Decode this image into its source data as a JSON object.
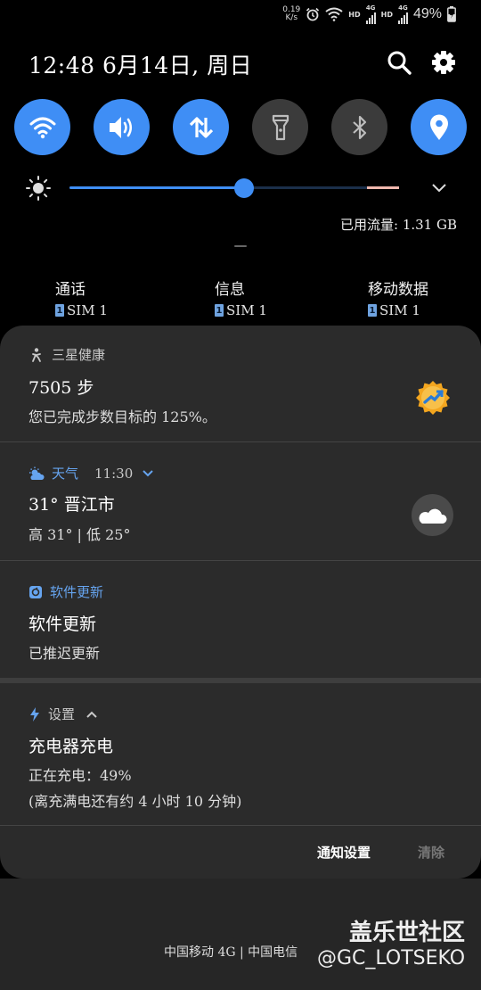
{
  "status_bar": {
    "net_speed_value": "0.19",
    "net_speed_unit": "K/s",
    "hd1": "HD",
    "net1": "4G",
    "hd2": "HD",
    "net2": "4G",
    "battery": "49%",
    "icons": [
      "alarm-icon",
      "wifi-icon",
      "signal-icon",
      "battery-charging-icon"
    ]
  },
  "header": {
    "datetime": "12:48  6月14日, 周日",
    "icons": [
      "search-icon",
      "gear-icon"
    ]
  },
  "quick_settings": {
    "toggles": [
      {
        "name": "wifi",
        "on": true
      },
      {
        "name": "sound",
        "on": true
      },
      {
        "name": "mobile-data",
        "on": true
      },
      {
        "name": "flashlight",
        "on": false
      },
      {
        "name": "bluetooth",
        "on": false
      },
      {
        "name": "location",
        "on": true
      }
    ],
    "brightness_level": 0.53,
    "data_used": "已用流量: 1.31 GB"
  },
  "sim": [
    {
      "title": "通话",
      "badge": "1",
      "label": "SIM 1"
    },
    {
      "title": "信息",
      "badge": "1",
      "label": "SIM 1"
    },
    {
      "title": "移动数据",
      "badge": "1",
      "label": "SIM 1"
    }
  ],
  "notifications": {
    "health": {
      "app": "三星健康",
      "title": "7505 步",
      "text": "您已完成步数目标的 125%。"
    },
    "weather": {
      "app": "天气",
      "time": "11:30",
      "title": "31° 晋江市",
      "text": "高 31° | 低 25°"
    },
    "update": {
      "app": "软件更新",
      "title": "软件更新",
      "text": "已推迟更新"
    },
    "charging": {
      "app": "设置",
      "title": "充电器充电",
      "line1": "正在充电：49%",
      "line2": "(离充满电还有约 4 小时 10 分钟)"
    }
  },
  "actions": {
    "settings": "通知设置",
    "clear": "清除"
  },
  "footer": {
    "carrier": "中国移动 4G | 中国电信"
  },
  "watermark": {
    "line1": "盖乐世社区",
    "line2": "@GC_LOTSEKO"
  },
  "colors": {
    "accent": "#3f8ef5",
    "panel": "#2b2b2b"
  }
}
